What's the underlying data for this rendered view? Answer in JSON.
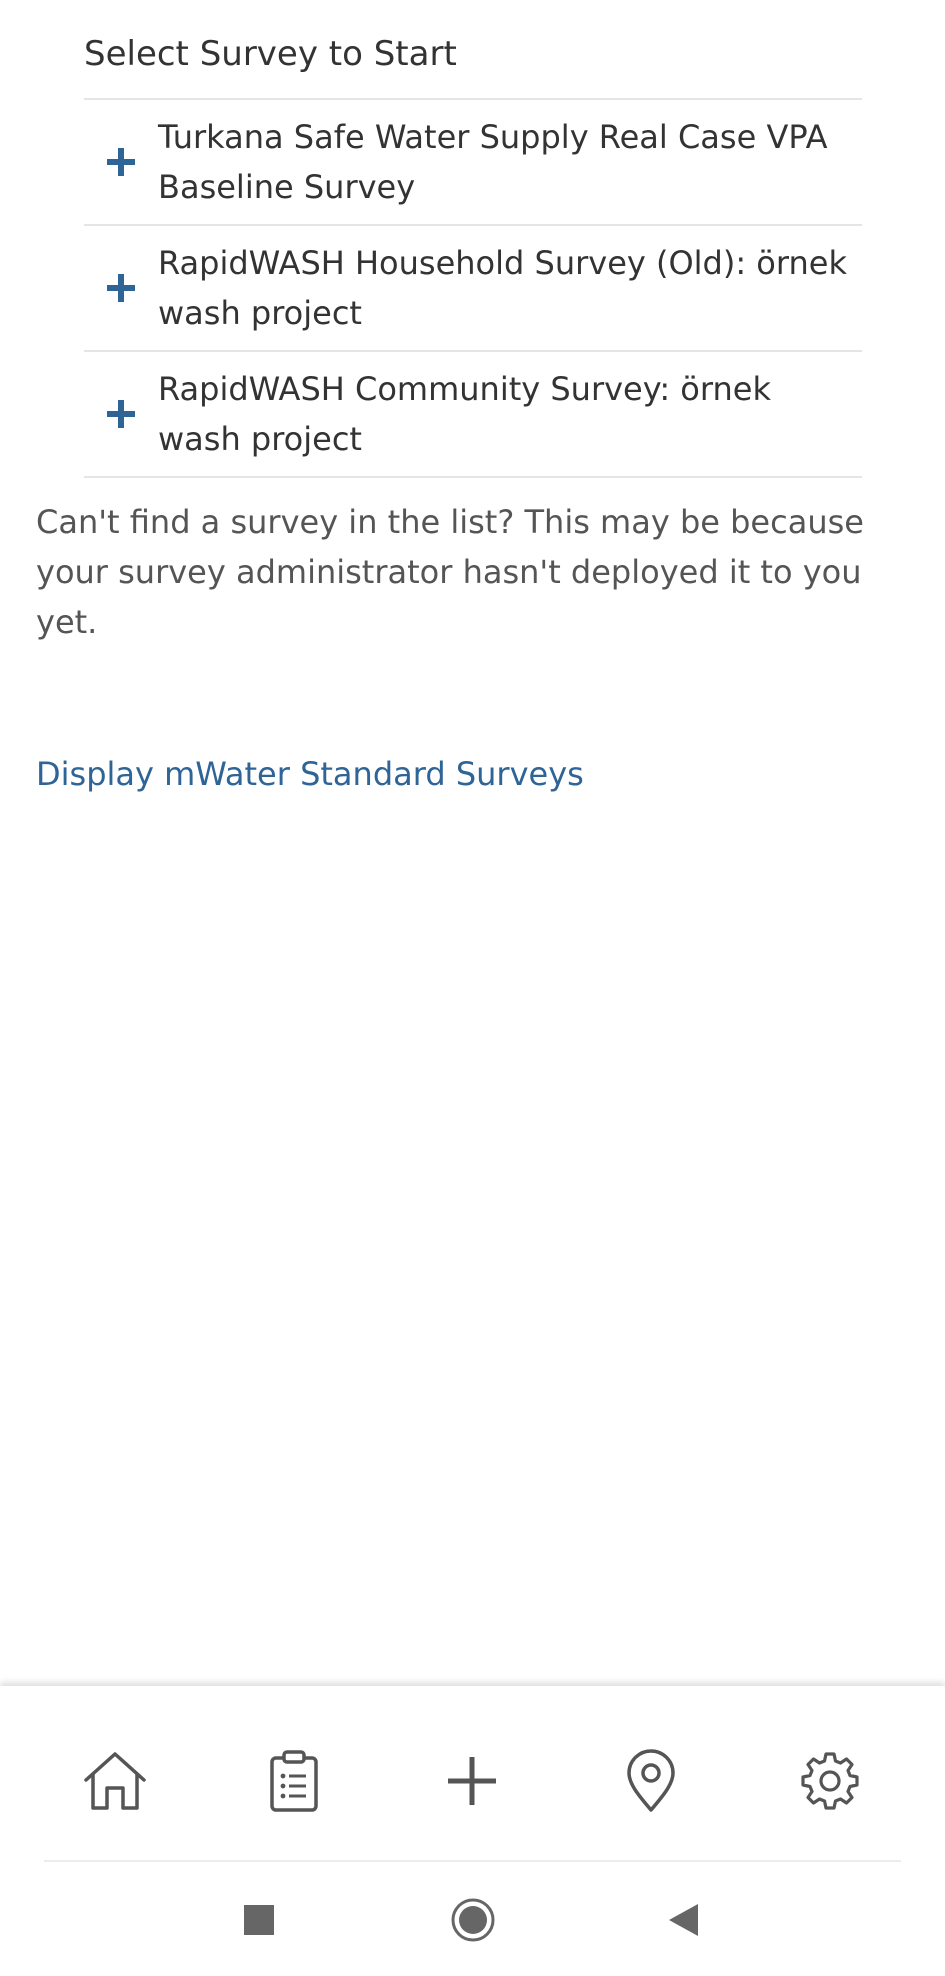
{
  "panel": {
    "title": "Select Survey to Start"
  },
  "surveys": [
    {
      "label": "Turkana Safe Water Supply Real Case VPA Baseline Survey",
      "icon": "plus-icon"
    },
    {
      "label": "RapidWASH Household Survey (Old): örnek wash project",
      "icon": "plus-icon"
    },
    {
      "label": "RapidWASH Community Survey: örnek wash project",
      "icon": "plus-icon"
    }
  ],
  "help_text": "Can't find a survey in the list? This may be because your survey administrator hasn't deployed it to you yet.",
  "standard_surveys_link": "Display mWater Standard Surveys",
  "bottom_nav": {
    "items": [
      "home-icon",
      "clipboard-list-icon",
      "add-icon",
      "map-pin-icon",
      "gear-icon"
    ]
  },
  "system_nav": {
    "items": [
      "recents-square-icon",
      "home-circle-icon",
      "back-triangle-icon"
    ]
  },
  "colors": {
    "accent": "#2f6496",
    "text": "#333333",
    "divider": "#e5e5e5",
    "icon": "#555555"
  }
}
